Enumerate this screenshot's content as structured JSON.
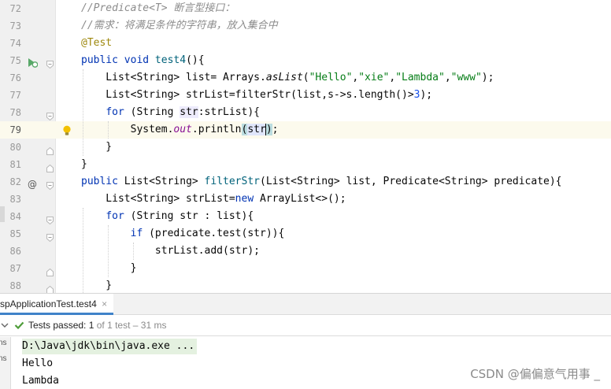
{
  "editor": {
    "lines": [
      {
        "num": "72",
        "parts": [
          {
            "t": "//Predicate<T> 断言型接口：",
            "c": "cmt"
          }
        ]
      },
      {
        "num": "73",
        "parts": [
          {
            "t": "//需求：将满足条件的字符串，放入集合中",
            "c": "cmt"
          }
        ]
      },
      {
        "num": "74",
        "parts": [
          {
            "t": "@Test",
            "c": "ann"
          }
        ]
      },
      {
        "num": "75",
        "parts": [
          {
            "t": "public void ",
            "c": "kw"
          },
          {
            "t": "test4",
            "c": "fnd"
          },
          {
            "t": "(){",
            "c": ""
          }
        ]
      },
      {
        "num": "76",
        "parts": [
          {
            "t": "    List<String> list= Arrays.",
            "c": ""
          },
          {
            "t": "asList",
            "c": "ita"
          },
          {
            "t": "(",
            "c": ""
          },
          {
            "t": "\"Hello\"",
            "c": "str"
          },
          {
            "t": ",",
            "c": ""
          },
          {
            "t": "\"xie\"",
            "c": "str"
          },
          {
            "t": ",",
            "c": ""
          },
          {
            "t": "\"Lambda\"",
            "c": "str"
          },
          {
            "t": ",",
            "c": ""
          },
          {
            "t": "\"www\"",
            "c": "str"
          },
          {
            "t": ");",
            "c": ""
          }
        ]
      },
      {
        "num": "77",
        "parts": [
          {
            "t": "    List<String> strList=filterStr(list,s->s.length()>",
            "c": ""
          },
          {
            "t": "3",
            "c": "num"
          },
          {
            "t": ");",
            "c": ""
          }
        ]
      },
      {
        "num": "78",
        "parts": [
          {
            "t": "    ",
            "c": ""
          },
          {
            "t": "for",
            "c": "kw"
          },
          {
            "t": " (String ",
            "c": ""
          },
          {
            "t": "str",
            "c": "hl"
          },
          {
            "t": ":strList){",
            "c": ""
          }
        ]
      },
      {
        "num": "79",
        "parts": [
          {
            "t": "        System.",
            "c": ""
          },
          {
            "t": "out",
            "c": "sta"
          },
          {
            "t": ".println",
            "c": ""
          },
          {
            "t": "(",
            "c": "hl2"
          },
          {
            "t": "str",
            "c": "hl3"
          },
          {
            "t": "|",
            "c": "caret"
          },
          {
            "t": ")",
            "c": "hl2"
          },
          {
            "t": ";",
            "c": ""
          }
        ]
      },
      {
        "num": "80",
        "parts": [
          {
            "t": "    }",
            "c": ""
          }
        ]
      },
      {
        "num": "81",
        "parts": [
          {
            "t": "}",
            "c": ""
          }
        ]
      },
      {
        "num": "82",
        "parts": [
          {
            "t": "public ",
            "c": "kw"
          },
          {
            "t": "List<String> ",
            "c": ""
          },
          {
            "t": "filterStr",
            "c": "fnd"
          },
          {
            "t": "(List<String> list, Predicate<String> predicate){",
            "c": ""
          }
        ]
      },
      {
        "num": "83",
        "parts": [
          {
            "t": "    List<String> strList=",
            "c": ""
          },
          {
            "t": "new ",
            "c": "kw"
          },
          {
            "t": "ArrayList<>();",
            "c": ""
          }
        ]
      },
      {
        "num": "84",
        "parts": [
          {
            "t": "    ",
            "c": ""
          },
          {
            "t": "for",
            "c": "kw"
          },
          {
            "t": " (String str : list){",
            "c": ""
          }
        ]
      },
      {
        "num": "85",
        "parts": [
          {
            "t": "        ",
            "c": ""
          },
          {
            "t": "if",
            "c": "kw"
          },
          {
            "t": " (predicate.test(str)){",
            "c": ""
          }
        ]
      },
      {
        "num": "86",
        "parts": [
          {
            "t": "            strList.add(str);",
            "c": ""
          }
        ]
      },
      {
        "num": "87",
        "parts": [
          {
            "t": "        }",
            "c": ""
          }
        ]
      },
      {
        "num": "88",
        "parts": [
          {
            "t": "    }",
            "c": ""
          }
        ]
      }
    ],
    "current_line": "79",
    "gutter_icons": {
      "75": "run-test-icon",
      "79": "lightbulb-icon",
      "82": "override-at-icon"
    }
  },
  "run_panel": {
    "tab_label": "spApplicationTest.test4",
    "tab_close": "×",
    "status": {
      "collapse_icon": "chevron-down-icon",
      "check_icon": "check-icon",
      "prefix": "Tests passed: ",
      "passed": "1",
      "suffix": " of 1 test – 31 ms"
    },
    "side_labels": [
      "ns",
      "ns"
    ],
    "console": [
      "D:\\Java\\jdk\\bin\\java.exe ...",
      "Hello",
      "Lambda"
    ]
  },
  "watermark": "CSDN @偏偏意气用事 _",
  "colors": {
    "keyword": "#0033b3",
    "comment": "#8c8c8c",
    "annotation": "#9e880d",
    "string": "#067d17",
    "number": "#1750eb",
    "function": "#00627a",
    "static_field": "#871094",
    "passed_check": "#4f9d3a",
    "tab_underline": "#4083c9",
    "current_line_bg": "#fcfaed"
  }
}
